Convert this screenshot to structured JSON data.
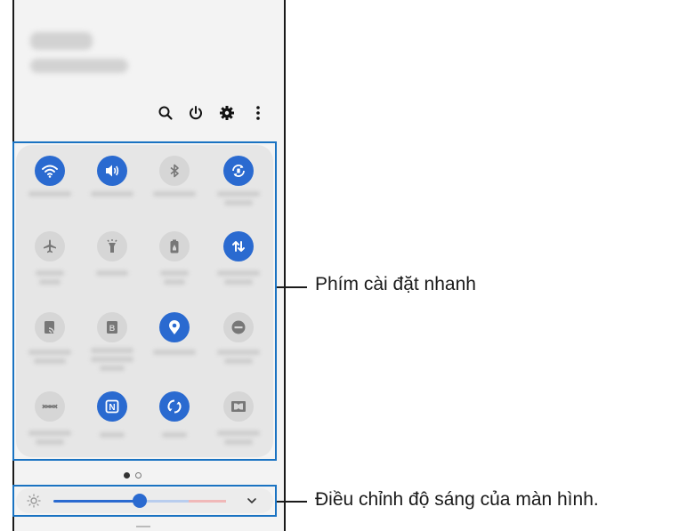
{
  "header": {
    "top_icons": [
      "search-icon",
      "power-icon",
      "gear-icon",
      "more-vert-icon"
    ]
  },
  "quick_settings": {
    "tiles": [
      {
        "icon": "wifi-icon",
        "state": "on"
      },
      {
        "icon": "sound-icon",
        "state": "on"
      },
      {
        "icon": "bluetooth-icon",
        "state": "off"
      },
      {
        "icon": "auto-rotate-icon",
        "state": "on"
      },
      {
        "icon": "airplane-icon",
        "state": "off"
      },
      {
        "icon": "flashlight-icon",
        "state": "off"
      },
      {
        "icon": "battery-saver-icon",
        "state": "off"
      },
      {
        "icon": "mobile-data-icon",
        "state": "on"
      },
      {
        "icon": "cast-icon",
        "state": "off"
      },
      {
        "icon": "bixby-icon",
        "state": "off"
      },
      {
        "icon": "location-icon",
        "state": "on"
      },
      {
        "icon": "do-not-disturb-icon",
        "state": "off"
      },
      {
        "icon": "nearby-share-icon",
        "state": "off"
      },
      {
        "icon": "nfc-icon",
        "state": "on"
      },
      {
        "icon": "sync-icon",
        "state": "on"
      },
      {
        "icon": "dolby-icon",
        "state": "off"
      }
    ],
    "page_index": 1,
    "page_count": 2
  },
  "brightness": {
    "level": 0.34,
    "icon": "brightness-icon",
    "expand_icon": "chevron-down-icon"
  },
  "annotations": {
    "quick_settings_label": "Phím cài đặt nhanh",
    "brightness_label": "Điều chỉnh độ sáng của màn hình."
  },
  "colors": {
    "accent": "#2a6ad0",
    "callout_frame": "#1a73c2"
  }
}
